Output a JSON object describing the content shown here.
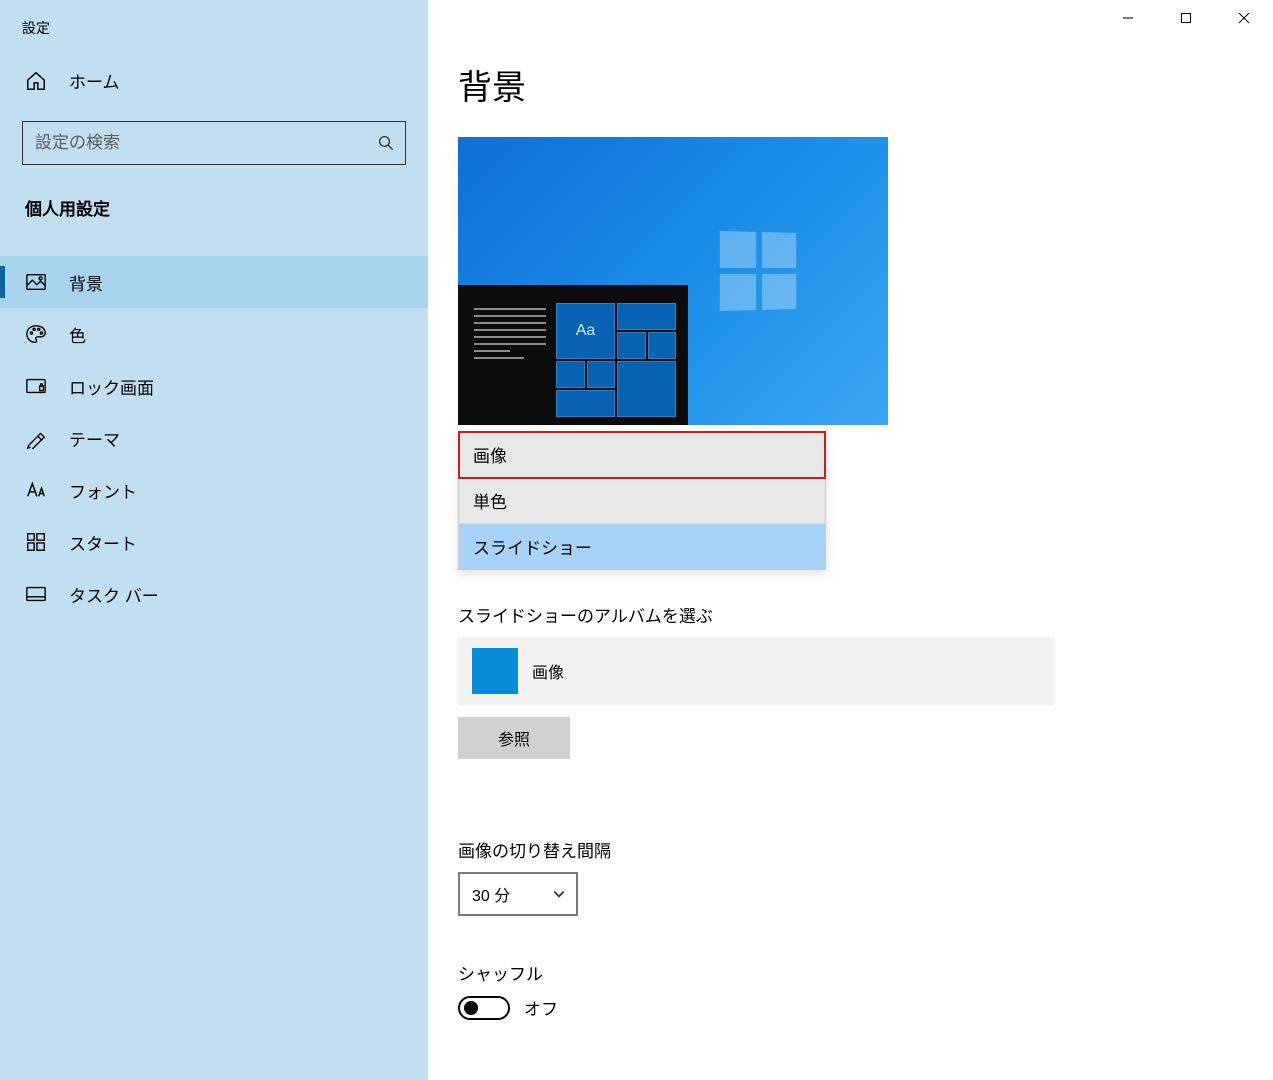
{
  "window": {
    "title": "設定"
  },
  "sidebar": {
    "home": "ホーム",
    "search_placeholder": "設定の検索",
    "category": "個人用設定",
    "items": [
      {
        "label": "背景",
        "icon": "picture"
      },
      {
        "label": "色",
        "icon": "palette"
      },
      {
        "label": "ロック画面",
        "icon": "lock-screen"
      },
      {
        "label": "テーマ",
        "icon": "theme"
      },
      {
        "label": "フォント",
        "icon": "font"
      },
      {
        "label": "スタート",
        "icon": "start"
      },
      {
        "label": "タスク バー",
        "icon": "taskbar"
      }
    ]
  },
  "main": {
    "title": "背景",
    "preview_sample": "Aa",
    "background_dropdown": {
      "options": [
        "画像",
        "単色",
        "スライドショー"
      ],
      "highlighted_index": 0,
      "selected_index": 2
    },
    "album_section": {
      "label": "スライドショーのアルバムを選ぶ",
      "selected_album": "画像",
      "browse_button": "参照"
    },
    "interval_section": {
      "label": "画像の切り替え間隔",
      "value": "30 分"
    },
    "shuffle_section": {
      "label": "シャッフル",
      "state_label": "オフ",
      "state": false
    }
  }
}
